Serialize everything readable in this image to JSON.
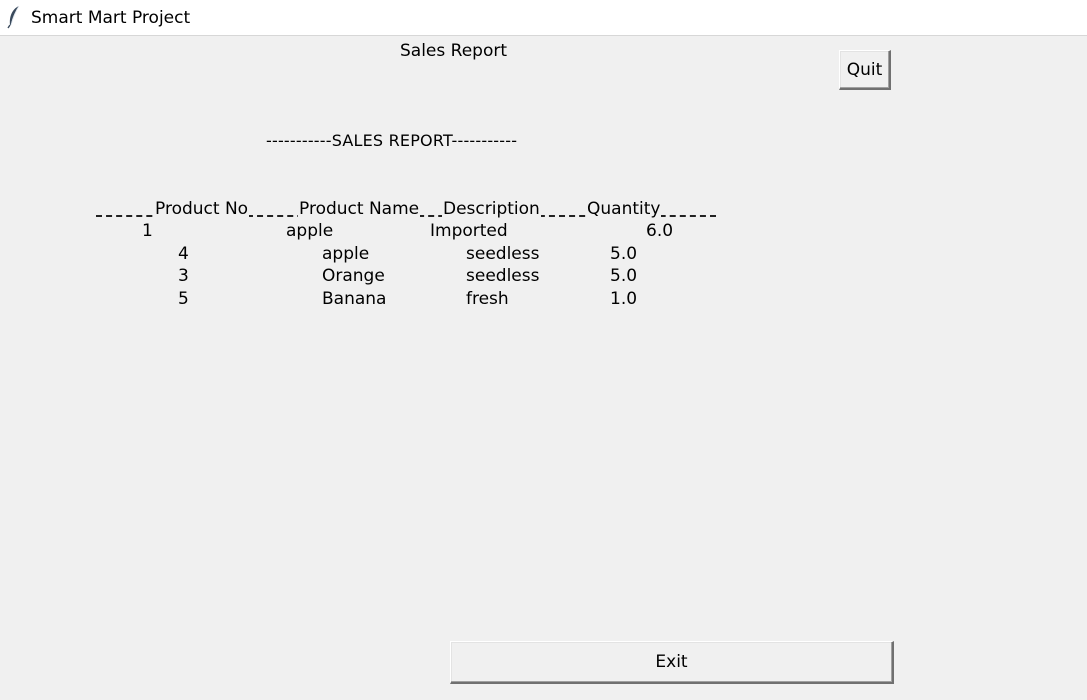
{
  "window": {
    "title": "Smart Mart Project",
    "icon": "feather-icon"
  },
  "header": {
    "title": "Sales Report"
  },
  "buttons": {
    "quit": "Quit",
    "exit": "Exit"
  },
  "report": {
    "banner": "-----------SALES REPORT-----------",
    "header_line": "--------Product No--------Product Name---Description----------Quantity-------",
    "columns": [
      "Product No",
      "Product Name",
      "Description",
      "Quantity"
    ],
    "first_row": {
      "no": "1",
      "name": "apple",
      "description": "Imported",
      "quantity": "6.0"
    },
    "rows": [
      {
        "no": "4",
        "name": "apple",
        "description": "seedless",
        "quantity": "5.0"
      },
      {
        "no": "3",
        "name": "Orange",
        "description": "seedless",
        "quantity": "5.0"
      },
      {
        "no": "5",
        "name": "Banana",
        "description": "fresh",
        "quantity": "1.0"
      }
    ]
  }
}
